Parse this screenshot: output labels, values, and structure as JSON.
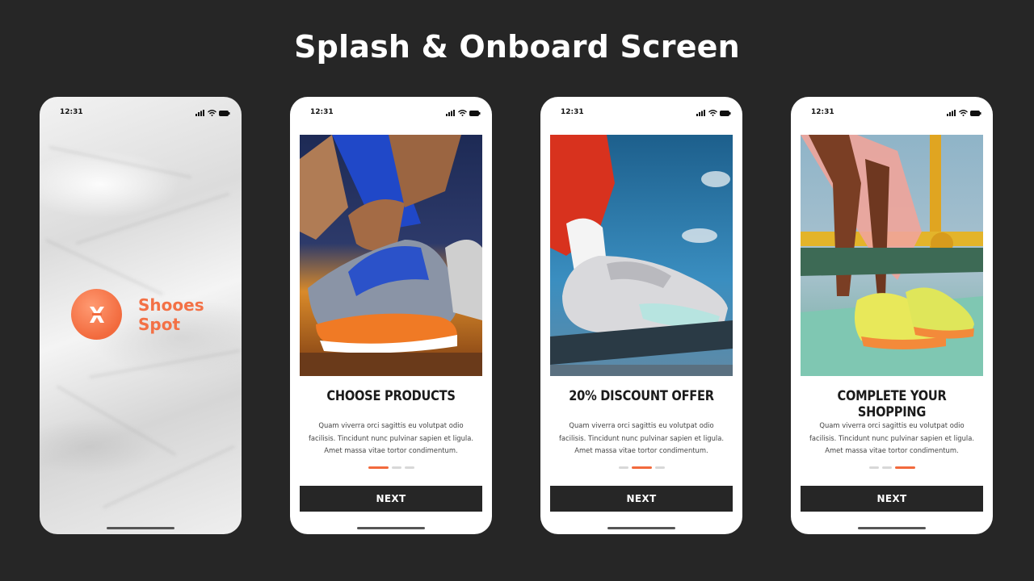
{
  "page": {
    "title": "Splash & Onboard Screen"
  },
  "colors": {
    "accent": "#f26a3d",
    "background": "#262626",
    "button": "#262626"
  },
  "splash": {
    "time": "12:31",
    "brand_line1": "Shooes",
    "brand_line2": "Spot",
    "logo_icon": "shoes-spot-logo-icon"
  },
  "onboard": [
    {
      "time": "12:31",
      "title": "CHOOSE PRODUCTS",
      "body": "Quam viverra orci sagittis eu volutpat odio facilisis. Tincidunt nunc pulvinar sapien et ligula. Amet massa vitae tortor condimentum.",
      "button": "NEXT",
      "active_dot": 1,
      "dots": 3
    },
    {
      "time": "12:31",
      "title": "20% DISCOUNT OFFER",
      "body": "Quam viverra orci sagittis eu volutpat odio facilisis. Tincidunt nunc pulvinar sapien et ligula. Amet massa vitae tortor condimentum.",
      "button": "NEXT",
      "active_dot": 2,
      "dots": 3
    },
    {
      "time": "12:31",
      "title": "COMPLETE YOUR SHOPPING",
      "body": "Quam viverra orci sagittis eu volutpat odio facilisis. Tincidunt nunc pulvinar sapien et ligula. Amet massa vitae tortor condimentum.",
      "button": "NEXT",
      "active_dot": 3,
      "dots": 3
    }
  ]
}
